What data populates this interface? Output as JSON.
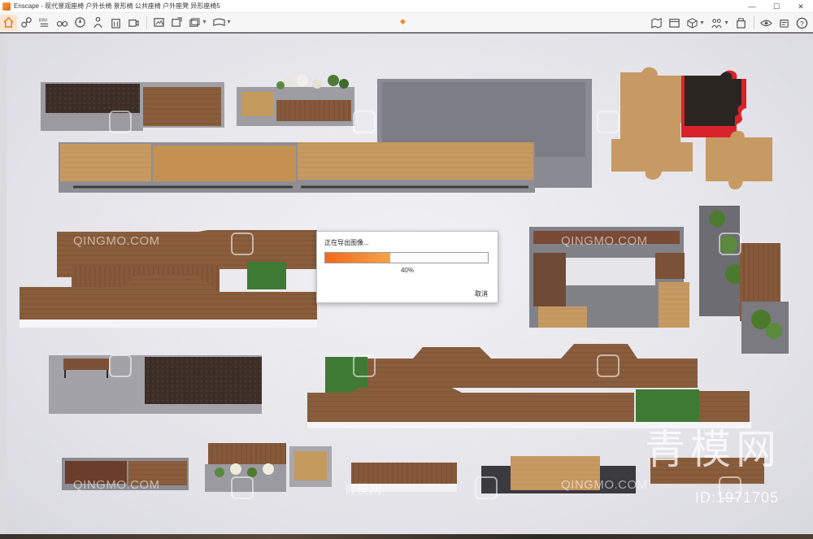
{
  "window": {
    "title": "Enscape - 现代景观座椅 户外长椅 景形椅 公共座椅 户外座凳 异形座椅5",
    "minimize": "—",
    "maximize": "☐",
    "close": "✕"
  },
  "toolbar": {
    "left_icons": [
      "home-icon",
      "link-icon",
      "bim-icon",
      "binoculars-icon",
      "compass-icon",
      "person-icon",
      "building-icon",
      "camera-icon",
      "screenshot-icon",
      "export-image-icon",
      "batch-render-icon",
      "video-icon",
      "panorama-icon"
    ],
    "center_marker": "◆",
    "right_icons": [
      "map-icon",
      "asset-library-icon",
      "cube-icon",
      "people-icon",
      "materials-icon",
      "eye-icon",
      "settings-icon",
      "help-icon"
    ]
  },
  "dialog": {
    "title": "正在导出图像...",
    "progress": 0.4,
    "percent_label": "40%",
    "cancel_label": "取消"
  },
  "watermarks": {
    "site": "QINGMO.COM",
    "site_cn": "青模网",
    "brand": "青模网",
    "id": "ID:1971705"
  },
  "colors": {
    "accent": "#f28b1f",
    "progress_start": "#f26a1b",
    "progress_end": "#f7a347",
    "wood": "#8a5e3c",
    "grass": "#3f7a34",
    "puzzle_red": "#d8232a"
  }
}
